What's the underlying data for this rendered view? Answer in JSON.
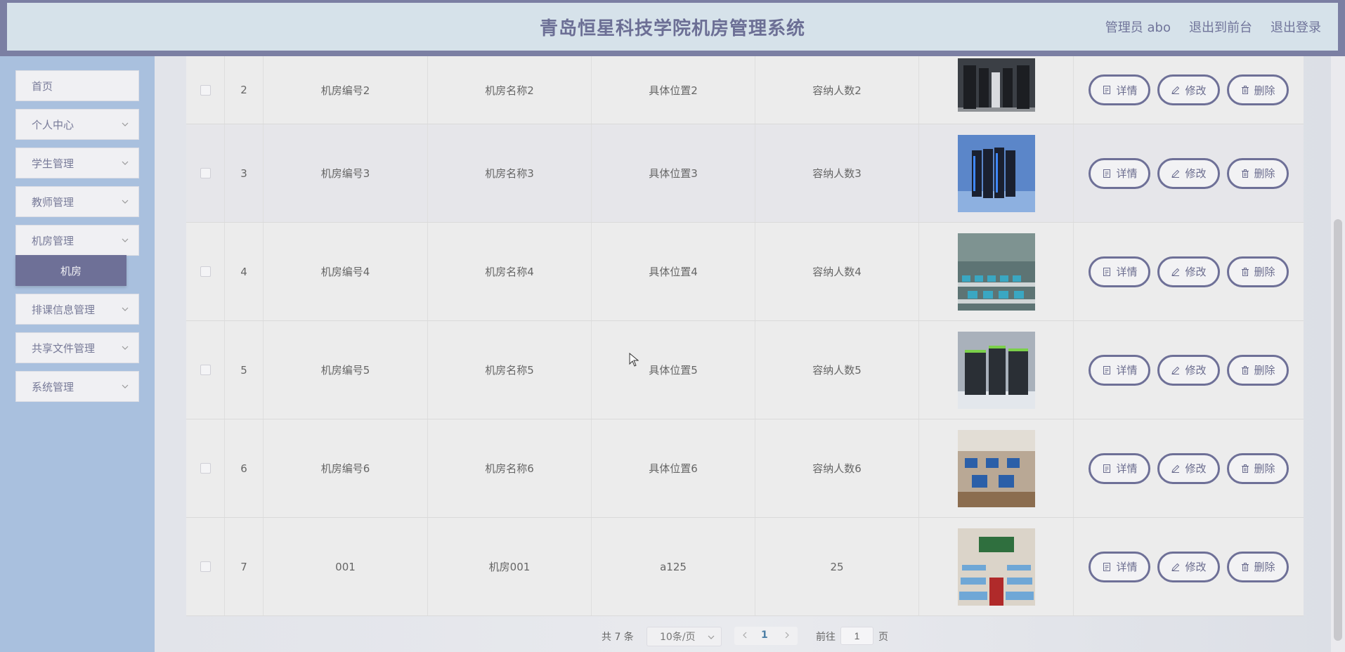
{
  "header": {
    "title": "青岛恒星科技学院机房管理系统",
    "user": "管理员 abo",
    "front": "退出到前台",
    "logout": "退出登录"
  },
  "sidebar": {
    "items": [
      {
        "label": "首页"
      },
      {
        "label": "个人中心"
      },
      {
        "label": "学生管理"
      },
      {
        "label": "教师管理"
      },
      {
        "label": "机房管理"
      },
      {
        "label": "排课信息管理"
      },
      {
        "label": "共享文件管理"
      },
      {
        "label": "系统管理"
      }
    ],
    "active_sub": "机房"
  },
  "table": {
    "rows": [
      {
        "index": "2",
        "num": "机房编号2",
        "name": "机房名称2",
        "loc": "具体位置2",
        "cap": "容纳人数2",
        "img": "server-room-dark"
      },
      {
        "index": "3",
        "num": "机房编号3",
        "name": "机房名称3",
        "loc": "具体位置3",
        "cap": "容纳人数3",
        "img": "server-room-blue"
      },
      {
        "index": "4",
        "num": "机房编号4",
        "name": "机房名称4",
        "loc": "具体位置4",
        "cap": "容纳人数4",
        "img": "computer-lab-teal"
      },
      {
        "index": "5",
        "num": "机房编号5",
        "name": "机房名称5",
        "loc": "具体位置5",
        "cap": "容纳人数5",
        "img": "server-racks-green"
      },
      {
        "index": "6",
        "num": "机房编号6",
        "name": "机房名称6",
        "loc": "具体位置6",
        "cap": "容纳人数6",
        "img": "computer-lab-desks"
      },
      {
        "index": "7",
        "num": "001",
        "name": "机房001",
        "loc": "a125",
        "cap": "25",
        "img": "classroom-red-carpet"
      }
    ],
    "ops": {
      "detail": "详情",
      "edit": "修改",
      "delete": "删除"
    }
  },
  "pager": {
    "total": "共 7 条",
    "size": "10条/页",
    "current": "1",
    "goto_pre": "前往",
    "goto_value": "1",
    "goto_post": "页"
  },
  "colors": {
    "header_bar": "#7b7fa3",
    "header_bg": "#d6e2ea",
    "sidebar_bg": "#a9c0de",
    "accent": "#6e7097"
  }
}
